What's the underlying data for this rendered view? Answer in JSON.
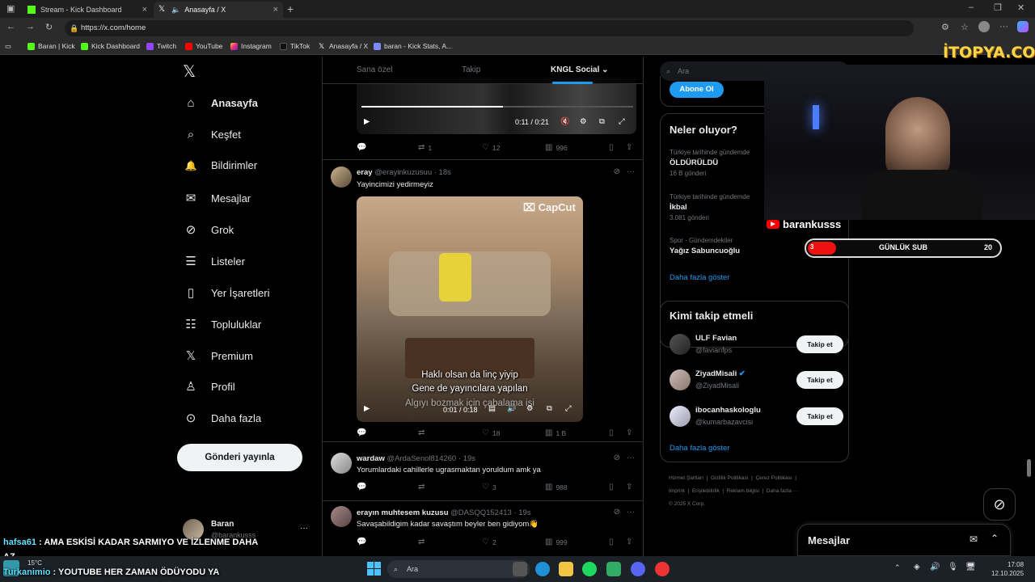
{
  "browser": {
    "tabs": [
      {
        "label": "Stream - Kick Dashboard",
        "active": false
      },
      {
        "label": "Anasayfa / X",
        "active": true
      }
    ],
    "url": "https://x.com/home",
    "bookmarks": [
      "Baran | Kick",
      "Kick Dashboard",
      "Twitch",
      "YouTube",
      "Instagram",
      "TikTok",
      "Anasayfa / X",
      "baran - Kick Stats, A..."
    ]
  },
  "nav": {
    "items": [
      {
        "label": "Anasayfa",
        "icon": "home-icon",
        "glyph": "⌂"
      },
      {
        "label": "Keşfet",
        "icon": "search-icon",
        "glyph": "⌕"
      },
      {
        "label": "Bildirimler",
        "icon": "bell-icon",
        "glyph": "🔔"
      },
      {
        "label": "Mesajlar",
        "icon": "mail-icon",
        "glyph": "✉"
      },
      {
        "label": "Grok",
        "icon": "grok-icon",
        "glyph": "⊘"
      },
      {
        "label": "Listeler",
        "icon": "list-icon",
        "glyph": "☰"
      },
      {
        "label": "Yer İşaretleri",
        "icon": "bookmark-icon",
        "glyph": "▯"
      },
      {
        "label": "Topluluklar",
        "icon": "communities-icon",
        "glyph": "☷"
      },
      {
        "label": "Premium",
        "icon": "x-logo-icon",
        "glyph": "𝕏"
      },
      {
        "label": "Profil",
        "icon": "person-icon",
        "glyph": "♙"
      },
      {
        "label": "Daha fazla",
        "icon": "more-circle-icon",
        "glyph": "⊙"
      }
    ],
    "post_button": "Gönderi yayınla",
    "profile": {
      "name": "Baran",
      "handle": "@barankusss"
    }
  },
  "feed": {
    "tabs": [
      "Sana özel",
      "Takip",
      "KNGL Social"
    ],
    "video1": {
      "time": "0:11 / 0:21",
      "actions": {
        "reply": "",
        "repost": "1",
        "like": "12",
        "views": "996"
      }
    },
    "tweets": [
      {
        "name": "eray",
        "handle": "@erayinkuzusuu",
        "time": "· 18s",
        "text": "Yayincimizi yedirmeyiz",
        "video": {
          "time": "0:01 / 0:18",
          "caption1": "Haklı olsan da linç yiyip",
          "caption2": "Gene de yayıncılara yapılan",
          "caption3": "Algıyı bozmak için çabalama işi",
          "watermark": "CapCut"
        },
        "actions": {
          "reply": "",
          "repost": "",
          "like": "18",
          "views": "1 B"
        }
      },
      {
        "name": "wardaw",
        "handle": "@ArdaSenol814260",
        "time": "· 19s",
        "text": "Yorumlardaki cahillerle ugrasmaktan yoruldum amk ya",
        "actions": {
          "reply": "",
          "repost": "",
          "like": "3",
          "views": "988"
        }
      },
      {
        "name": "erayın muhtesem kuzusu",
        "handle": "@DASQQ152413",
        "time": "· 19s",
        "text": "Savaşabildigim kadar savaştım beyler ben gidiyom👋",
        "actions": {
          "reply": "",
          "repost": "",
          "like": "2",
          "views": "999"
        }
      }
    ]
  },
  "right": {
    "search_placeholder": "Ara",
    "subscribe_button": "Abone Ol",
    "trends_title": "Neler oluyor?",
    "trends": [
      {
        "meta": "Türkiye tarihinde gündemde",
        "name": "ÖLDÜRÜLDÜ",
        "count": "16 B gönderi"
      },
      {
        "meta": "Türkiye tarihinde gündemde",
        "name": "İkbal",
        "count": "3.081 gönderi"
      },
      {
        "meta": "Spor · Gündemdekiler",
        "name": "Yağız Sabuncuoğlu",
        "count": ""
      }
    ],
    "show_more": "Daha fazla göster",
    "who_title": "Kimi takip etmeli",
    "who": [
      {
        "name": "ULF Favian",
        "handle": "@favianfps",
        "verified": false
      },
      {
        "name": "ZiyadMisali",
        "handle": "@ZiyadMisali",
        "verified": true
      },
      {
        "name": "ibocanhaskologlu",
        "handle": "@kumarbazavcisi",
        "verified": false
      }
    ],
    "follow_label": "Takip et",
    "footer": [
      "Hizmet Şartları",
      "|",
      "Gizlilik Politikası",
      "|",
      "Çerez Politikası",
      "|",
      "Imprint",
      "|",
      "Erişilebilirlik",
      "|",
      "Reklam bilgisi",
      "|",
      "Daha fazla ···",
      "© 2025 X Corp."
    ],
    "messages": "Mesajlar"
  },
  "stream": {
    "sponsor": "İTOPYA.COM",
    "youtube_name": "barankusss",
    "sub_goal": {
      "label": "GÜNLÜK SUB",
      "current": "3",
      "target": "20",
      "progress": 0.15
    },
    "chat": [
      {
        "user": "hafsa61",
        "text": " : AMA ESKİSİ KADAR SARMIYO VE İZLENME DAHA"
      },
      {
        "user": "",
        "text": "AZ"
      },
      {
        "user": "Turkanimio",
        "text": " : YOUTUBE HER ZAMAN ÖDÜYODU YA"
      }
    ]
  },
  "taskbar": {
    "search": "Ara",
    "weather": "15°C",
    "time": "17:08",
    "date": "12.10.2025"
  }
}
